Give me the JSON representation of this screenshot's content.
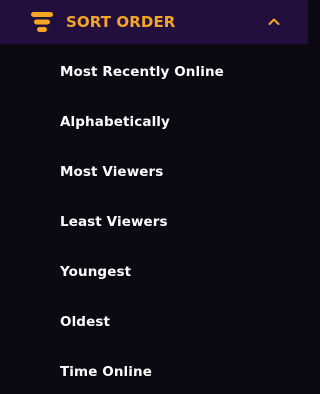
{
  "header": {
    "icon": "sort-lines-icon",
    "title": "SORT ORDER",
    "collapse_icon": "chevron-up-icon",
    "accent_color": "#f5a524",
    "background_color": "#230f3d"
  },
  "options": [
    {
      "label": "Most Recently Online"
    },
    {
      "label": "Alphabetically"
    },
    {
      "label": "Most Viewers"
    },
    {
      "label": "Least Viewers"
    },
    {
      "label": "Youngest"
    },
    {
      "label": "Oldest"
    },
    {
      "label": "Time Online"
    }
  ],
  "colors": {
    "page_background": "#0c0913",
    "option_text": "#ffffff"
  }
}
